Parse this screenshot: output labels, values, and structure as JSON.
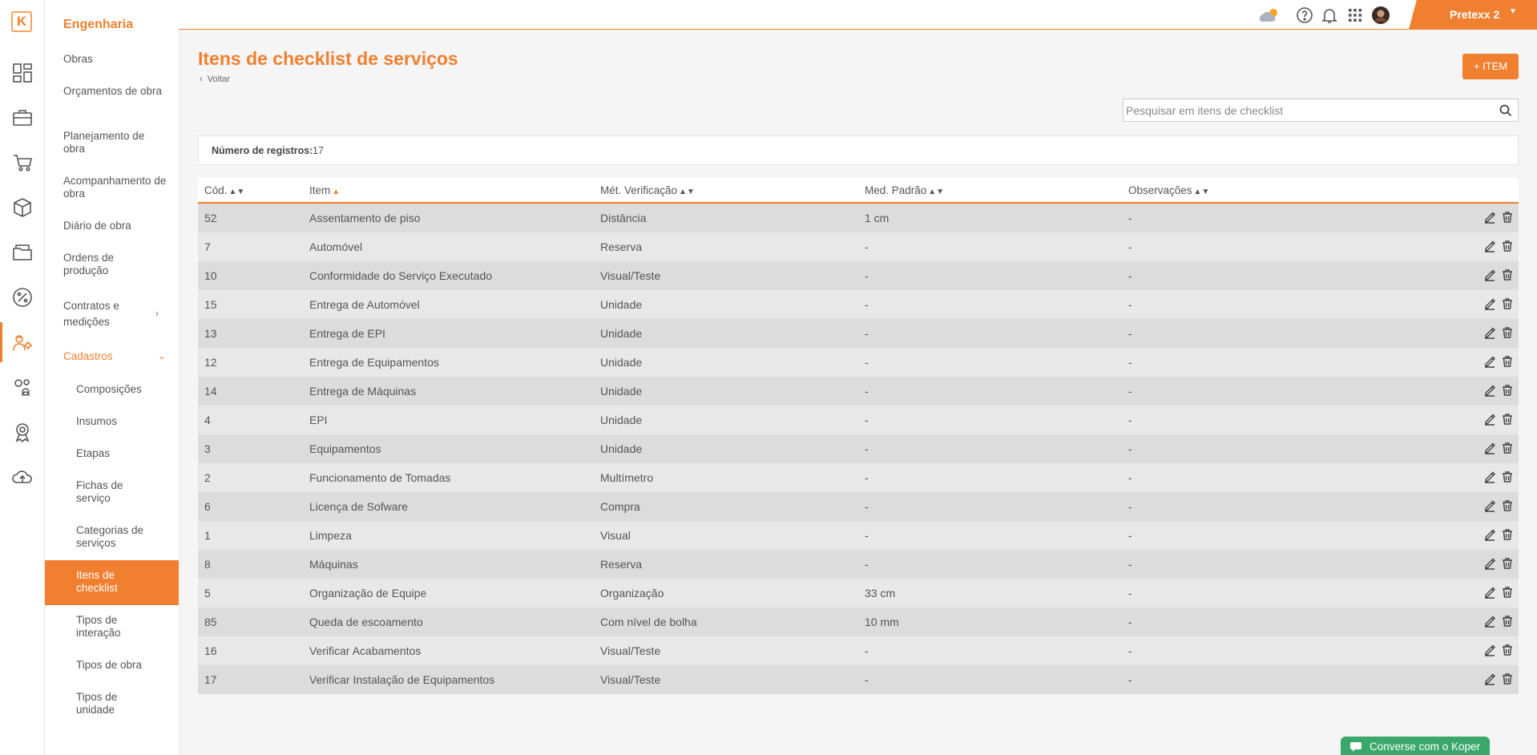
{
  "rail": {
    "logo": "K"
  },
  "sidebar": {
    "title": "Engenharia",
    "items": [
      "Obras",
      "Orçamentos de obra",
      "Planejamento de obra",
      "Acompanhamento de obra",
      "Diário de obra",
      "Ordens de produção",
      "Contratos e medições",
      "Cadastros"
    ],
    "subitems": [
      "Composições",
      "Insumos",
      "Etapas",
      "Fichas de serviço",
      "Categorias de serviços",
      "Itens de checklist",
      "Tipos de interação",
      "Tipos de obra",
      "Tipos de unidade"
    ]
  },
  "topbar": {
    "user": "Pretexx 2"
  },
  "page": {
    "title": "Itens de checklist de serviços",
    "back": "Voltar",
    "add_button": "+ ITEM",
    "search_placeholder": "Pesquisar em itens de checklist",
    "count_label": "Número de registros:",
    "count_value": "17"
  },
  "table": {
    "columns": [
      "Cód.",
      "Item",
      "Mét. Verificação",
      "Med. Padrão",
      "Observações"
    ],
    "rows": [
      [
        "52",
        "Assentamento de piso",
        "Distância",
        "1 cm",
        "-"
      ],
      [
        "7",
        "Automóvel",
        "Reserva",
        "-",
        "-"
      ],
      [
        "10",
        "Conformidade do Serviço Executado",
        "Visual/Teste",
        "-",
        "-"
      ],
      [
        "15",
        "Entrega de Automóvel",
        "Unidade",
        "-",
        "-"
      ],
      [
        "13",
        "Entrega de EPI",
        "Unidade",
        "-",
        "-"
      ],
      [
        "12",
        "Entrega de Equipamentos",
        "Unidade",
        "-",
        "-"
      ],
      [
        "14",
        "Entrega de Máquinas",
        "Unidade",
        "-",
        "-"
      ],
      [
        "4",
        "EPI",
        "Unidade",
        "-",
        "-"
      ],
      [
        "3",
        "Equipamentos",
        "Unidade",
        "-",
        "-"
      ],
      [
        "2",
        "Funcionamento de Tomadas",
        "Multímetro",
        "-",
        "-"
      ],
      [
        "6",
        "Licença de Sofware",
        "Compra",
        "-",
        "-"
      ],
      [
        "1",
        "Limpeza",
        "Visual",
        "-",
        "-"
      ],
      [
        "8",
        "Máquinas",
        "Reserva",
        "-",
        "-"
      ],
      [
        "5",
        "Organização de Equipe",
        "Organização",
        "33 cm",
        "-"
      ],
      [
        "85",
        "Queda de escoamento",
        "Com nível de bolha",
        "10 mm",
        "-"
      ],
      [
        "16",
        "Verificar Acabamentos",
        "Visual/Teste",
        "-",
        "-"
      ],
      [
        "17",
        "Verificar Instalação de Equipamentos",
        "Visual/Teste",
        "-",
        "-"
      ]
    ]
  },
  "chat": {
    "label": "Converse com o Koper"
  },
  "colors": {
    "accent": "#f08030",
    "chat": "#3aa86a"
  }
}
